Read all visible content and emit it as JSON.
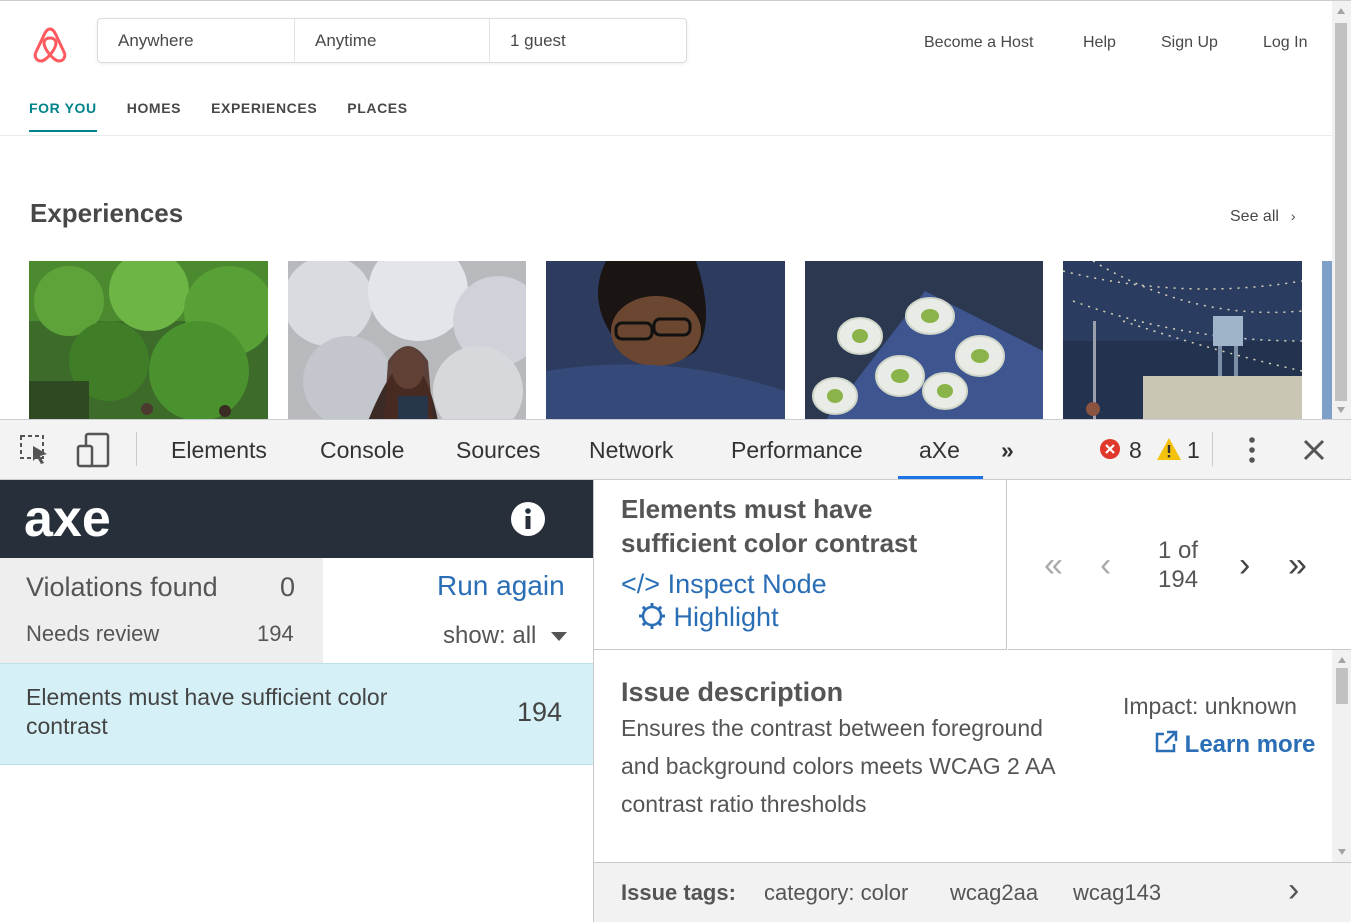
{
  "website": {
    "search": {
      "where": "Anywhere",
      "when": "Anytime",
      "guests": "1 guest"
    },
    "nav": [
      "Become a Host",
      "Help",
      "Sign Up",
      "Log In"
    ],
    "tabs": [
      "FOR YOU",
      "HOMES",
      "EXPERIENCES",
      "PLACES"
    ],
    "section_title": "Experiences",
    "see_all": "See all",
    "brand_color": "#ff5a5f",
    "accent_color": "#008489"
  },
  "devtools": {
    "tabs": [
      "Elements",
      "Console",
      "Sources",
      "Network",
      "Performance",
      "aXe"
    ],
    "active_tab": "aXe",
    "more_tabs_icon": "»",
    "error_count": "8",
    "warning_count": "1"
  },
  "axe": {
    "logo": "axe",
    "violations_label": "Violations found",
    "violations_count": "0",
    "needs_review_label": "Needs review",
    "needs_review_count": "194",
    "run_again": "Run again",
    "show_filter": "show: all",
    "rule_title": "Elements must have sufficient color contrast",
    "rule_title_line1": "Elements must have sufficient color",
    "rule_title_line2": "contrast",
    "rule_count": "194",
    "detail_title_line1": "Elements must have",
    "detail_title_line2": "sufficient color contrast",
    "inspect_node": "Inspect Node",
    "highlight": "Highlight",
    "pager_line1": "1 of",
    "pager_line2": "194",
    "issue_heading": "Issue description",
    "issue_text_1": "Ensures the contrast between foreground",
    "issue_text_2": "and background colors meets WCAG 2 AA",
    "issue_text_3": "contrast ratio thresholds",
    "impact": "Impact: unknown",
    "learn_more": "Learn more",
    "tags_label": "Issue tags:",
    "tags": [
      "category: color",
      "wcag2aa",
      "wcag143"
    ]
  }
}
